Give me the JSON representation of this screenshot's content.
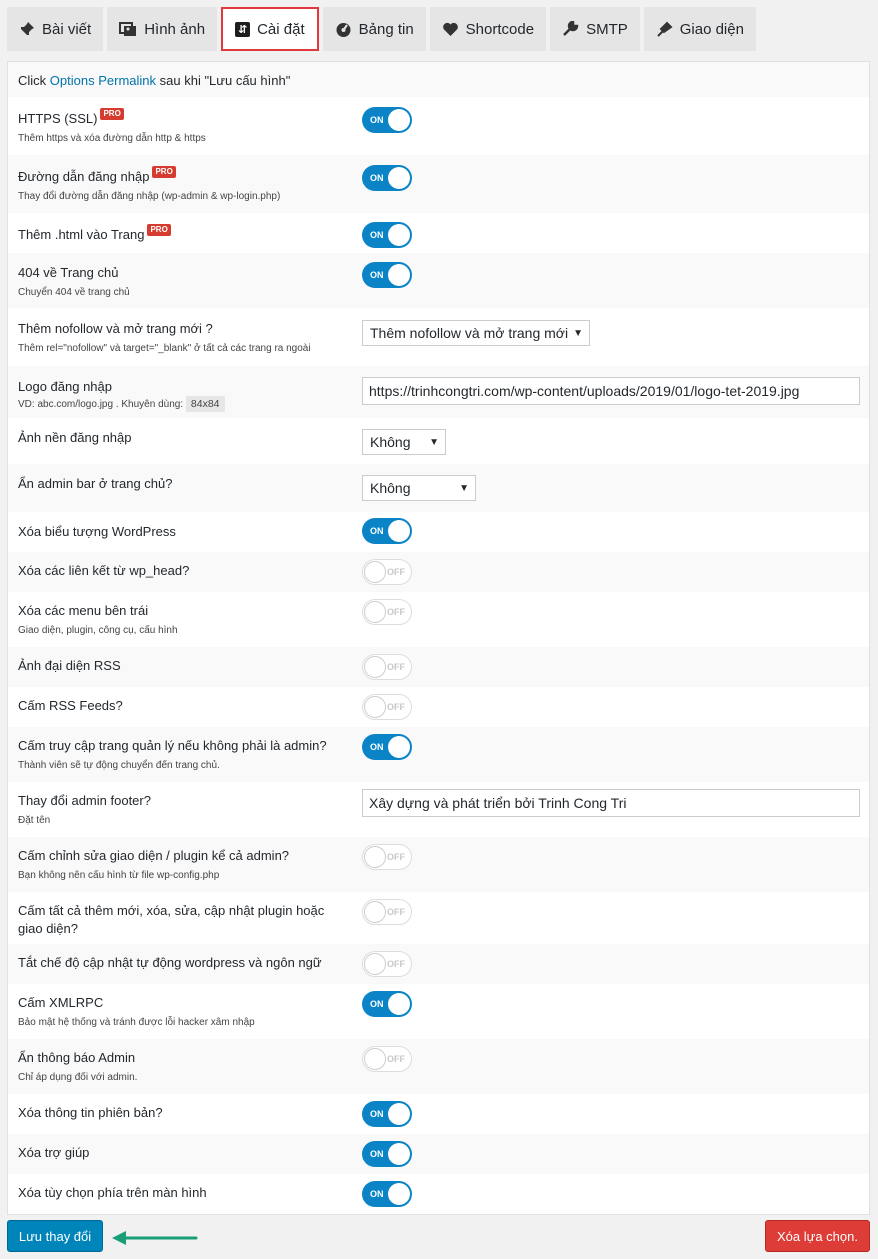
{
  "tabs": [
    {
      "label": "Bài viết",
      "icon": "pin-icon"
    },
    {
      "label": "Hình ảnh",
      "icon": "images-icon"
    },
    {
      "label": "Cài đặt",
      "icon": "settings-icon"
    },
    {
      "label": "Bảng tin",
      "icon": "dashboard-icon"
    },
    {
      "label": "Shortcode",
      "icon": "heart-icon"
    },
    {
      "label": "SMTP",
      "icon": "wrench-icon"
    },
    {
      "label": "Giao diện",
      "icon": "brush-icon"
    }
  ],
  "notice": {
    "prefix": "Click",
    "link": "Options Permalink",
    "suffix": "sau khi \"Lưu cấu hình\""
  },
  "pro_badge": "PRO",
  "toggle_on": "ON",
  "toggle_off": "OFF",
  "rows": {
    "https": {
      "label": "HTTPS (SSL)",
      "desc": "Thêm https và xóa đường dẫn http & https",
      "state": "on"
    },
    "login_path": {
      "label": "Đường dẫn đăng nhập",
      "desc": "Thay đổi đường dẫn đăng nhập (wp-admin & wp-login.php)",
      "state": "on"
    },
    "html_page": {
      "label": "Thêm .html vào Trang",
      "state": "on"
    },
    "404": {
      "label": "404 về Trang chủ",
      "desc": "Chuyển 404 về trang chủ",
      "state": "on"
    },
    "nofollow": {
      "label": "Thêm nofollow và mở trang mới ?",
      "desc": "Thêm rel=\"nofollow\" và target=\"_blank\" ở tất cả các trang ra ngoài",
      "value": "Thêm nofollow và mở trang mới"
    },
    "logo": {
      "label": "Logo đăng nhập",
      "desc": "VD: abc.com/logo.jpg . Khuyên dùng:",
      "size": "84x84",
      "value": "https://trinhcongtri.com/wp-content/uploads/2019/01/logo-tet-2019.jpg"
    },
    "login_bg": {
      "label": "Ảnh nền đăng nhập",
      "value": "Không"
    },
    "hide_adminbar": {
      "label": "Ẩn admin bar ở trang chủ?",
      "value": "Không"
    },
    "wp_icon": {
      "label": "Xóa biểu tượng WordPress",
      "state": "on"
    },
    "wp_head": {
      "label": "Xóa các liên kết từ wp_head?",
      "state": "off"
    },
    "left_menu": {
      "label": "Xóa các menu bên trái",
      "desc": "Giao diện, plugin, công cụ, cấu hình",
      "state": "off"
    },
    "rss_img": {
      "label": "Ảnh đại diện RSS",
      "state": "off"
    },
    "rss_ban": {
      "label": "Cấm RSS Feeds?",
      "state": "off"
    },
    "admin_access": {
      "label": "Cấm truy cập trang quản lý nếu không phải là admin?",
      "desc": "Thành viên sẽ tự động chuyển đến trang chủ.",
      "state": "on"
    },
    "footer": {
      "label": "Thay đổi admin footer?",
      "desc": "Đặt tên",
      "value": "Xây dựng và phát triển bởi Trinh Cong Tri"
    },
    "edit_ban": {
      "label": "Cấm chỉnh sửa giao diện / plugin kể cả admin?",
      "desc": "Bạn không nên cấu hình từ file wp-config.php",
      "state": "off"
    },
    "plugin_ban": {
      "label": "Cấm tất cả thêm mới, xóa, sửa, cập nhật plugin hoặc giao diện?",
      "state": "off"
    },
    "auto_update": {
      "label": "Tắt chế độ cập nhật tự động wordpress và ngôn ngữ",
      "state": "off"
    },
    "xmlrpc": {
      "label": "Cấm XMLRPC",
      "desc": "Bảo mật hệ thống và tránh được lỗi hacker xâm nhập",
      "state": "on"
    },
    "admin_notice": {
      "label": "Ẩn thông báo Admin",
      "desc": "Chỉ áp dụng đối với admin.",
      "state": "off"
    },
    "version": {
      "label": "Xóa thông tin phiên bản?",
      "state": "on"
    },
    "help": {
      "label": "Xóa trợ giúp",
      "state": "on"
    },
    "screen_opts": {
      "label": "Xóa tùy chọn phía trên màn hình",
      "state": "on"
    }
  },
  "buttons": {
    "save": "Lưu thay đổi",
    "clear": "Xóa lựa chọn."
  },
  "colors": {
    "accent": "#0085ba",
    "toggle_on": "#0a84c6",
    "danger": "#dd3d36",
    "highlight": "#e0393e",
    "arrow": "#1a9e78"
  }
}
